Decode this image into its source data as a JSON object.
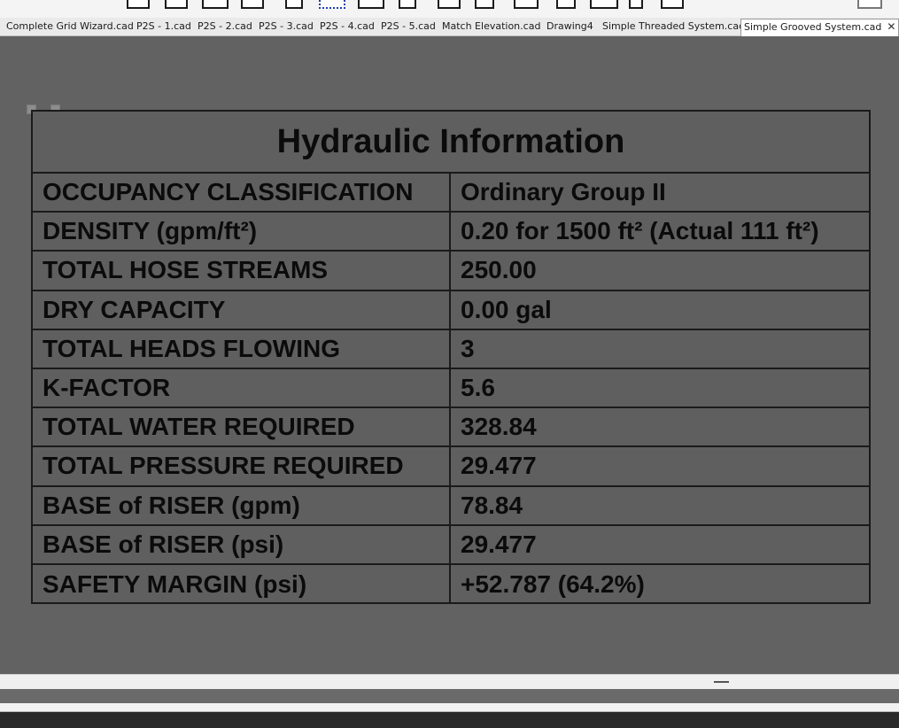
{
  "tabs": [
    {
      "label": "Complete Grid Wizard.cad"
    },
    {
      "label": "P2S - 1.cad"
    },
    {
      "label": "P2S - 2.cad"
    },
    {
      "label": "P2S - 3.cad"
    },
    {
      "label": "P2S - 4.cad"
    },
    {
      "label": "P2S - 5.cad"
    },
    {
      "label": "Match Elevation.cad"
    },
    {
      "label": "Drawing4"
    },
    {
      "label": "Simple Threaded System.cad"
    },
    {
      "label": "Simple Grooved System.cad",
      "active": true,
      "close_glyph": "✕"
    }
  ],
  "table": {
    "title": "Hydraulic Information",
    "rows": [
      {
        "label": "OCCUPANCY CLASSIFICATION",
        "value": "Ordinary Group II"
      },
      {
        "label": "DENSITY (gpm/ft²)",
        "value": "0.20 for 1500 ft² (Actual 111 ft²)"
      },
      {
        "label": "TOTAL HOSE STREAMS",
        "value": "250.00"
      },
      {
        "label": "DRY CAPACITY",
        "value": "0.00 gal"
      },
      {
        "label": "TOTAL HEADS FLOWING",
        "value": "3"
      },
      {
        "label": "K-FACTOR",
        "value": "5.6"
      },
      {
        "label": "TOTAL WATER REQUIRED",
        "value": "328.84"
      },
      {
        "label": "TOTAL PRESSURE REQUIRED",
        "value": "29.477"
      },
      {
        "label": "BASE of RISER (gpm)",
        "value": "78.84"
      },
      {
        "label": "BASE of RISER (psi)",
        "value": "29.477"
      },
      {
        "label": "SAFETY MARGIN (psi)",
        "value": "+52.787 (64.2%)"
      }
    ]
  },
  "colors": {
    "canvas": "#626262",
    "table_lines": "#1a1a1a",
    "text": "#0b0b0b"
  }
}
